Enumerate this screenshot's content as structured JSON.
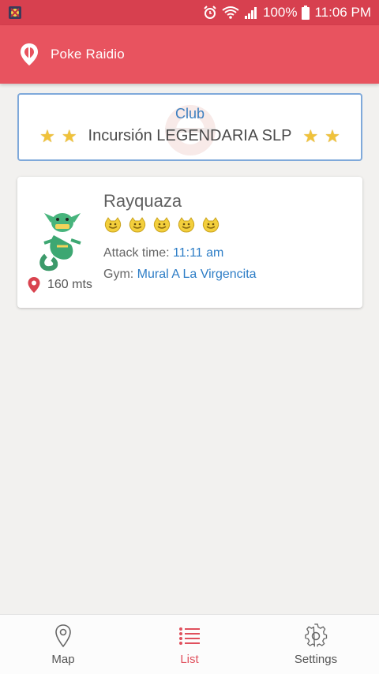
{
  "status_bar": {
    "battery": "100%",
    "time": "11:06 PM",
    "icons": [
      "app-badge-icon",
      "alarm-icon",
      "wifi-icon",
      "signal-icon",
      "battery-icon"
    ]
  },
  "app_bar": {
    "title": "Poke Raidio",
    "icon": "location-pin-logo"
  },
  "club": {
    "label": "Club",
    "name": "Incursión LEGENDARIA SLP",
    "icon": "star-icon"
  },
  "raid": {
    "pokemon": "Rayquaza",
    "difficulty": 5,
    "attack_label": "Attack time:",
    "attack_time": "11:11 am",
    "gym_label": "Gym:",
    "gym_name": "Mural A La Virgencita",
    "distance": "160 mts"
  },
  "nav": {
    "items": [
      {
        "label": "Map",
        "icon": "map-pin-icon",
        "active": false
      },
      {
        "label": "List",
        "icon": "list-icon",
        "active": true
      },
      {
        "label": "Settings",
        "icon": "gear-icon",
        "active": false
      }
    ]
  },
  "colors": {
    "status_bar": "#d7404f",
    "app_bar": "#e8535f",
    "link": "#2d7dc6",
    "active_tab": "#e0505d",
    "club_border": "#7fa9da"
  }
}
